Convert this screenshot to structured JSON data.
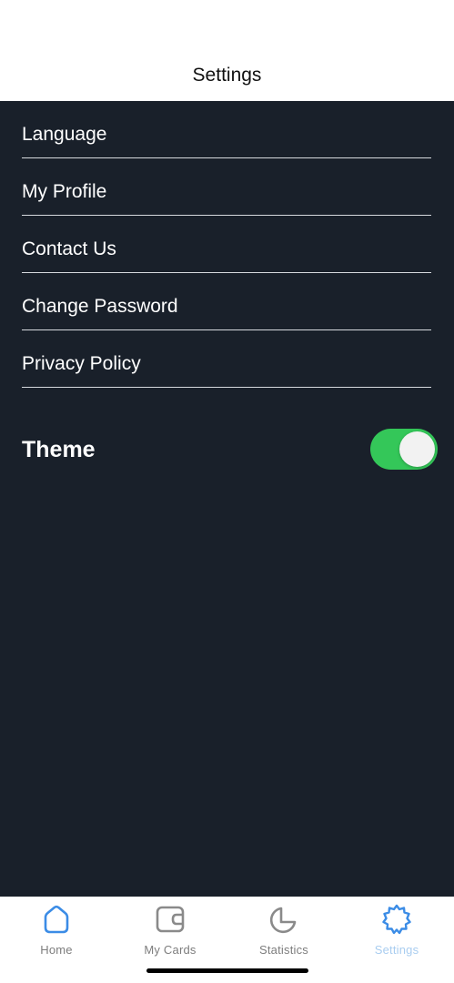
{
  "header": {
    "title": "Settings"
  },
  "menu": {
    "items": [
      {
        "label": "Language"
      },
      {
        "label": "My Profile"
      },
      {
        "label": "Contact Us"
      },
      {
        "label": "Change Password"
      },
      {
        "label": "Privacy Policy"
      }
    ]
  },
  "theme": {
    "label": "Theme",
    "enabled": true,
    "toggle_on_color": "#34c759"
  },
  "tabbar": {
    "tabs": [
      {
        "label": "Home",
        "icon": "home-icon",
        "active": false
      },
      {
        "label": "My Cards",
        "icon": "wallet-icon",
        "active": false
      },
      {
        "label": "Statistics",
        "icon": "pie-chart-icon",
        "active": false
      },
      {
        "label": "Settings",
        "icon": "gear-icon",
        "active": true
      }
    ]
  },
  "colors": {
    "background": "#19202a",
    "header_bg": "#ffffff",
    "accent_blue": "#3b8ce6",
    "active_tab_label": "#a9cdf0",
    "inactive_tab": "#7d7d7d"
  }
}
